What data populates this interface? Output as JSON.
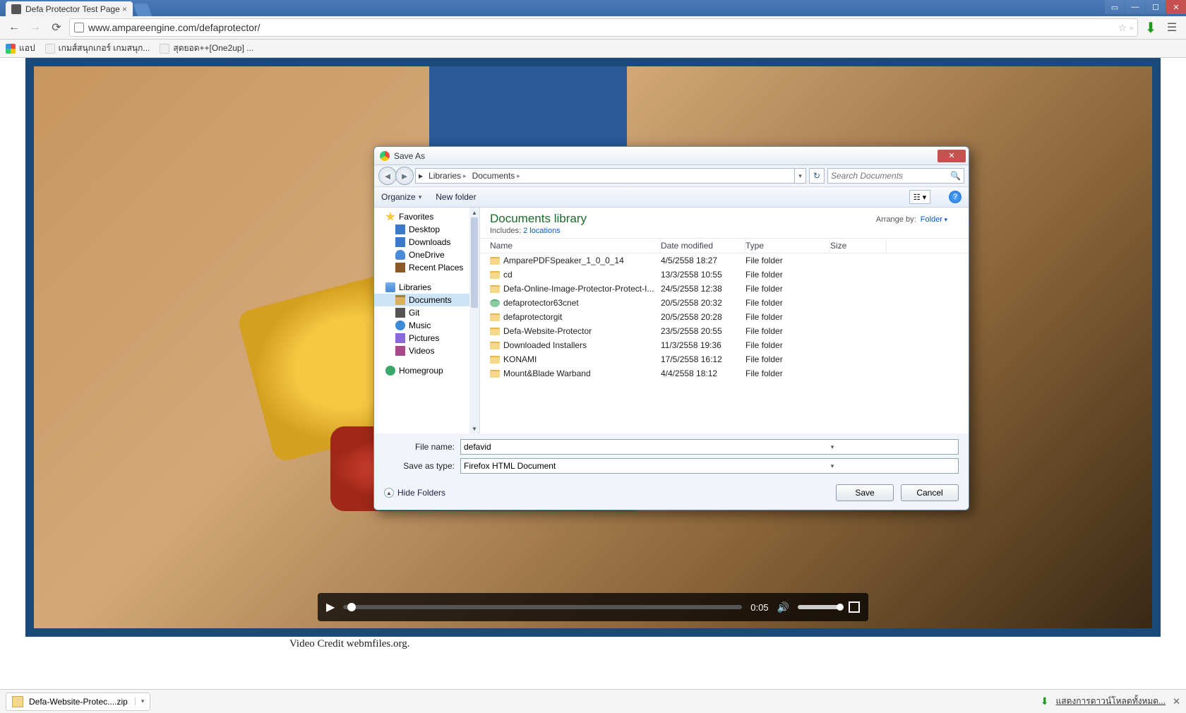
{
  "browser": {
    "tab_title": "Defa Protector Test Page",
    "url": "www.ampareengine.com/defaprotector/",
    "bookmarks": [
      {
        "label": "แอป"
      },
      {
        "label": "เกมส์สนุกเกอร์ เกมสนุก..."
      },
      {
        "label": "สุดยอด++[One2up] ..."
      }
    ]
  },
  "page": {
    "video_time": "0:05",
    "credit": "Video Credit webmfiles.org."
  },
  "dialog": {
    "title": "Save As",
    "breadcrumb": [
      "Libraries",
      "Documents"
    ],
    "search_placeholder": "Search Documents",
    "organize_label": "Organize",
    "newfolder_label": "New folder",
    "lib_title": "Documents library",
    "includes_label": "Includes:",
    "includes_link": "2 locations",
    "arrange_label": "Arrange by:",
    "arrange_value": "Folder",
    "tree": {
      "favorites_label": "Favorites",
      "favorites": [
        "Desktop",
        "Downloads",
        "OneDrive",
        "Recent Places"
      ],
      "libraries_label": "Libraries",
      "libraries": [
        "Documents",
        "Git",
        "Music",
        "Pictures",
        "Videos"
      ],
      "homegroup_label": "Homegroup"
    },
    "columns": {
      "name": "Name",
      "date": "Date modified",
      "type": "Type",
      "size": "Size"
    },
    "files": [
      {
        "name": "AmparePDFSpeaker_1_0_0_14",
        "date": "4/5/2558 18:27",
        "type": "File folder",
        "alt": false
      },
      {
        "name": "cd",
        "date": "13/3/2558 10:55",
        "type": "File folder",
        "alt": false
      },
      {
        "name": "Defa-Online-Image-Protector-Protect-I...",
        "date": "24/5/2558 12:38",
        "type": "File folder",
        "alt": false
      },
      {
        "name": "defaprotector63cnet",
        "date": "20/5/2558 20:32",
        "type": "File folder",
        "alt": true
      },
      {
        "name": "defaprotectorgit",
        "date": "20/5/2558 20:28",
        "type": "File folder",
        "alt": false
      },
      {
        "name": "Defa-Website-Protector",
        "date": "23/5/2558 20:55",
        "type": "File folder",
        "alt": false
      },
      {
        "name": "Downloaded Installers",
        "date": "11/3/2558 19:36",
        "type": "File folder",
        "alt": false
      },
      {
        "name": "KONAMI",
        "date": "17/5/2558 16:12",
        "type": "File folder",
        "alt": false
      },
      {
        "name": "Mount&Blade Warband",
        "date": "4/4/2558 18:12",
        "type": "File folder",
        "alt": false
      }
    ],
    "filename_label": "File name:",
    "filename_value": "defavid",
    "saveastype_label": "Save as type:",
    "saveastype_value": "Firefox HTML Document",
    "hide_folders": "Hide Folders",
    "save_btn": "Save",
    "cancel_btn": "Cancel"
  },
  "downloadbar": {
    "item": "Defa-Website-Protec....zip",
    "show_all": "แสดงการดาวน์โหลดทั้งหมด..."
  }
}
